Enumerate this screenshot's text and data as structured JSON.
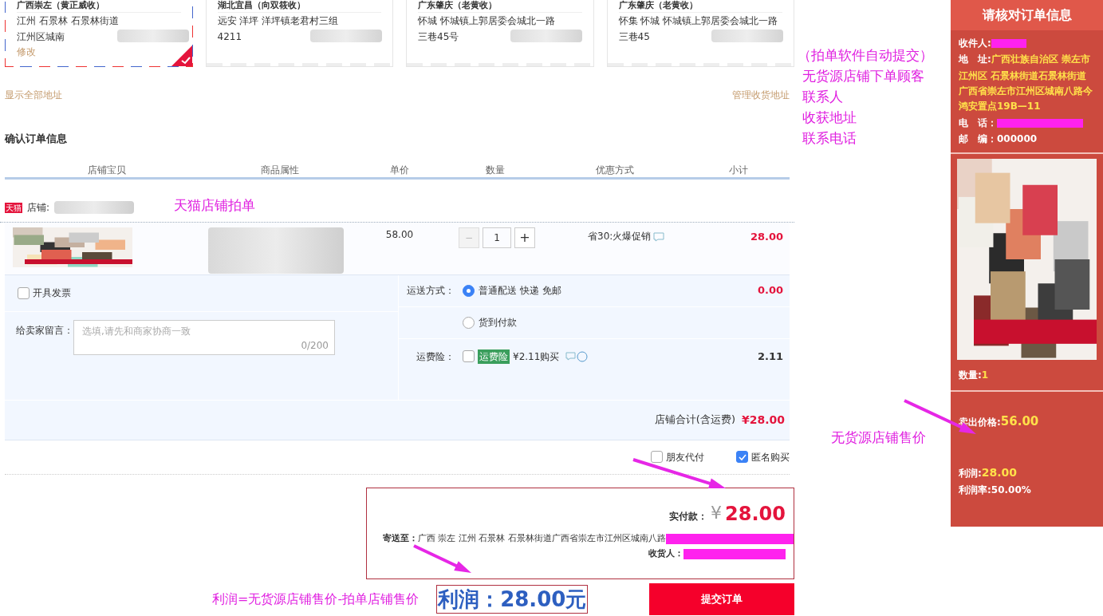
{
  "address_cards": [
    {
      "title": "广西崇左（黄正威收）",
      "lines": [
        "江州 石景林 石景林街道",
        "江州区城南"
      ],
      "edit_link": "修改",
      "selected": true
    },
    {
      "title": "湖北宜昌（向双筱收）",
      "lines": [
        "远安 洋坪 洋坪镇老君村三组",
        "4211"
      ],
      "selected": false
    },
    {
      "title": "广东肇庆（老黄收）",
      "lines": [
        "怀城 怀城镇上郭居委会城北一路",
        "三巷45号"
      ],
      "selected": false
    },
    {
      "title": "广东肇庆（老黄收）",
      "lines": [
        "怀集 怀城 怀城镇上郭居委会城北一路",
        "三巷45"
      ],
      "selected": false
    }
  ],
  "show_all_link": "显示全部地址",
  "manage_link": "管理收货地址",
  "section_title": "确认订单信息",
  "columns": [
    "店铺宝贝",
    "商品属性",
    "单价",
    "数量",
    "优惠方式",
    "小计"
  ],
  "shop": {
    "badge": "天猫",
    "label": "店铺:"
  },
  "item": {
    "price": "58.00",
    "minus": "−",
    "quantity": "1",
    "plus": "+",
    "discount": "省30:火爆促销",
    "subtotal": "28.00"
  },
  "invoice": {
    "label": "开具发票",
    "checked": false
  },
  "message": {
    "label": "给卖家留言：",
    "placeholder": "选填,请先和商家协商一致",
    "counter": "0/200"
  },
  "shipping": {
    "label": "运送方式：",
    "options": [
      {
        "label": "普通配送 快递 免邮",
        "selected": true
      },
      {
        "label": "货到付款",
        "selected": false
      }
    ],
    "fee": "0.00"
  },
  "insurance": {
    "label": "运费险：",
    "checked": false,
    "tag": "运费险",
    "price_text": "¥2.11购买",
    "fee": "2.11"
  },
  "shop_total": {
    "label": "店铺合计(含运费)",
    "value": "¥28.00"
  },
  "options": [
    {
      "label": "朋友代付",
      "checked": false
    },
    {
      "label": "匿名购买",
      "checked": true
    }
  ],
  "summary": {
    "paid_label": "实付款：",
    "currency": "¥",
    "paid": "28.00",
    "ship_label": "寄送至：",
    "address": "广西 崇左 江州 石景林 石景林街道广西省崇左市江州区城南八路",
    "receiver_label": "收货人："
  },
  "profit_box": "利润：28.00元",
  "submit": "提交订单",
  "notes": {
    "tmall": "天猫店铺拍单",
    "side": [
      "（拍单软件自动提交）",
      "无货源店铺下单顾客",
      "联系人",
      "收获地址",
      "联系电话"
    ],
    "price": "无货源店铺售价",
    "formula": "利润=无货源店铺售价-拍单店铺售价"
  },
  "panel": {
    "title": "请核对订单信息",
    "receiver_label": "收件人:",
    "address_label": "地　址:",
    "address_first": "广西壮族自治区 崇左市",
    "address_rest": "江州区 石景林街道石景林街道广西省崇左市江州区城南八路今鸿安置点19B—11",
    "phone_label": "电　话：",
    "postcode": "邮　编：000000",
    "qty_label": "数量:",
    "qty": "1",
    "price_label": "卖出价格:",
    "price": "56.00",
    "profit_label": "利润:",
    "profit": "28.00",
    "rate": "利润率:50.00%"
  }
}
